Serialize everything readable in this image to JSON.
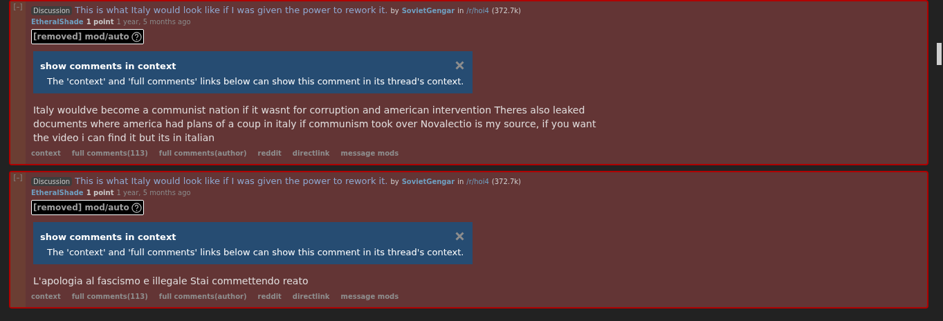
{
  "comments": [
    {
      "collapse": "[–]",
      "flair": "Discussion",
      "title": "This is what Italy would look like if I was given the power to rework it.",
      "by": "by",
      "post_author": "SovietGengar",
      "in": "in",
      "subreddit": "/r/hoi4",
      "subscribers": "(372.7k)",
      "author": "EtheralShade",
      "score": "1 point",
      "time": "1 year, 5 months ago",
      "removed": "[removed] mod/auto",
      "info_title": "show comments in context",
      "info_text": "The 'context' and 'full comments' links below can show this comment in its thread's context.",
      "body": "Italy wouldve become a communist nation if it wasnt for corruption and american intervention Theres also leaked documents where america had plans of a coup in italy if communism took over Novalectio is my source, if you want the video i can find it but its in italian",
      "links": [
        "context",
        "full comments(113)",
        "full comments(author)",
        "reddit",
        "directlink",
        "message mods"
      ]
    },
    {
      "collapse": "[–]",
      "flair": "Discussion",
      "title": "This is what Italy would look like if I was given the power to rework it.",
      "by": "by",
      "post_author": "SovietGengar",
      "in": "in",
      "subreddit": "/r/hoi4",
      "subscribers": "(372.7k)",
      "author": "EtheralShade",
      "score": "1 point",
      "time": "1 year, 5 months ago",
      "removed": "[removed] mod/auto",
      "info_title": "show comments in context",
      "info_text": "The 'context' and 'full comments' links below can show this comment in its thread's context.",
      "body": "L'apologia al fascismo e illegale Stai commettendo reato",
      "links": [
        "context",
        "full comments(113)",
        "full comments(author)",
        "reddit",
        "directlink",
        "message mods"
      ]
    }
  ]
}
